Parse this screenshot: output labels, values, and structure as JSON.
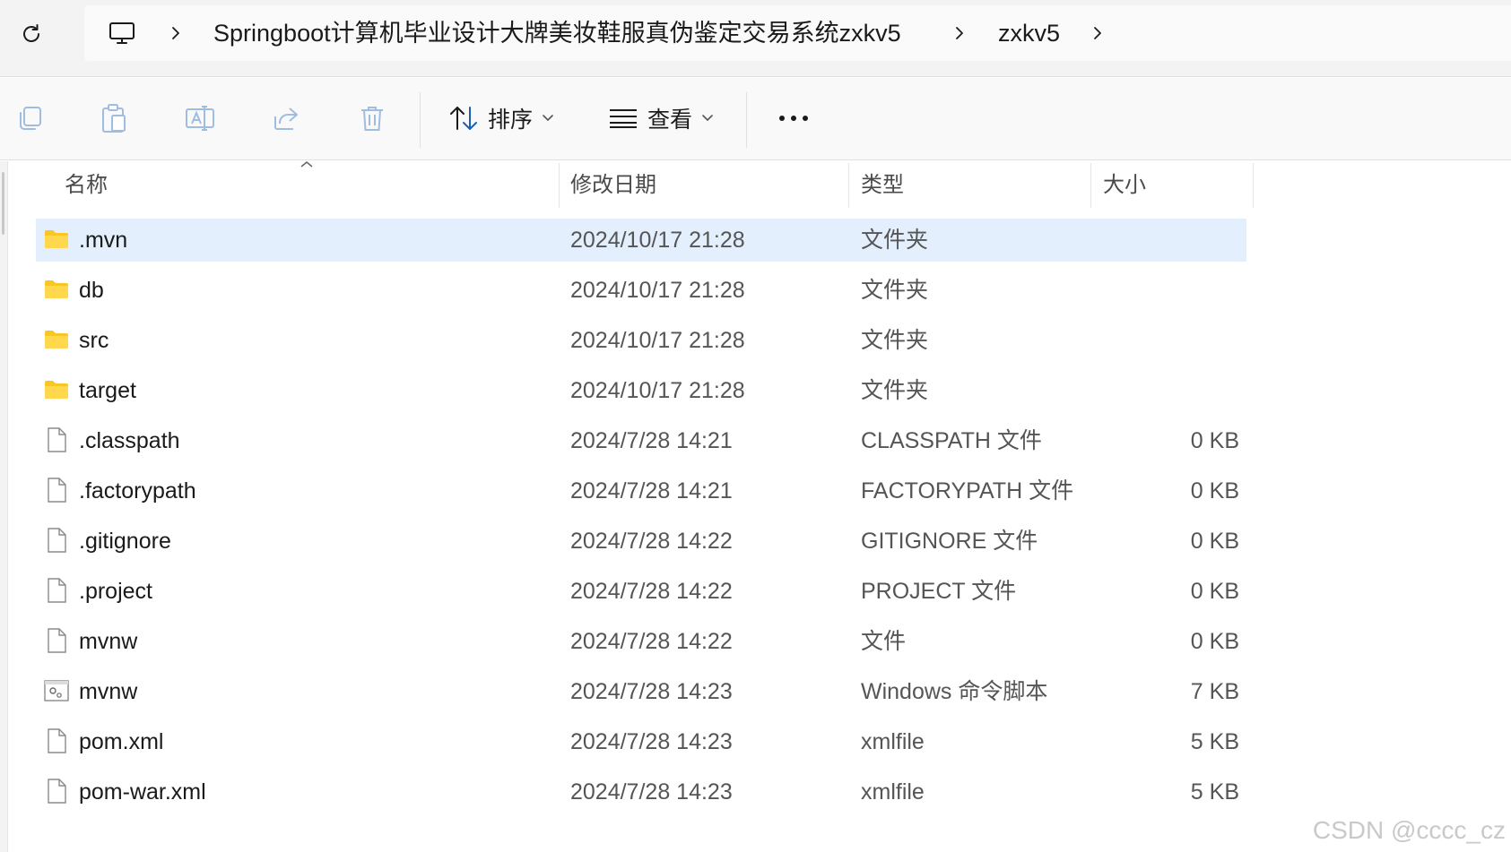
{
  "address_bar": {
    "crumbs": [
      "Springboot计算机毕业设计大牌美妆鞋服真伪鉴定交易系统zxkv5",
      "zxkv5"
    ]
  },
  "toolbar": {
    "sort_label": "排序",
    "view_label": "查看"
  },
  "columns": {
    "name": "名称",
    "modified": "修改日期",
    "type": "类型",
    "size": "大小"
  },
  "files": [
    {
      "name": ".mvn",
      "modified": "2024/10/17 21:28",
      "type": "文件夹",
      "size": "",
      "icon": "folder-icon",
      "selected": true
    },
    {
      "name": "db",
      "modified": "2024/10/17 21:28",
      "type": "文件夹",
      "size": "",
      "icon": "folder-icon"
    },
    {
      "name": "src",
      "modified": "2024/10/17 21:28",
      "type": "文件夹",
      "size": "",
      "icon": "folder-icon"
    },
    {
      "name": "target",
      "modified": "2024/10/17 21:28",
      "type": "文件夹",
      "size": "",
      "icon": "folder-icon"
    },
    {
      "name": ".classpath",
      "modified": "2024/7/28 14:21",
      "type": "CLASSPATH 文件",
      "size": "0 KB",
      "icon": "file-icon"
    },
    {
      "name": ".factorypath",
      "modified": "2024/7/28 14:21",
      "type": "FACTORYPATH 文件",
      "size": "0 KB",
      "icon": "file-icon"
    },
    {
      "name": ".gitignore",
      "modified": "2024/7/28 14:22",
      "type": "GITIGNORE 文件",
      "size": "0 KB",
      "icon": "file-icon"
    },
    {
      "name": ".project",
      "modified": "2024/7/28 14:22",
      "type": "PROJECT 文件",
      "size": "0 KB",
      "icon": "file-icon"
    },
    {
      "name": "mvnw",
      "modified": "2024/7/28 14:22",
      "type": "文件",
      "size": "0 KB",
      "icon": "file-icon"
    },
    {
      "name": "mvnw",
      "modified": "2024/7/28 14:23",
      "type": "Windows 命令脚本",
      "size": "7 KB",
      "icon": "script-file-icon"
    },
    {
      "name": "pom.xml",
      "modified": "2024/7/28 14:23",
      "type": "xmlfile",
      "size": "5 KB",
      "icon": "file-icon"
    },
    {
      "name": "pom-war.xml",
      "modified": "2024/7/28 14:23",
      "type": "xmlfile",
      "size": "5 KB",
      "icon": "file-icon"
    }
  ],
  "watermark": "CSDN @cccc_cz",
  "colors": {
    "selection": "#e3effc",
    "folder": "#f9c623",
    "toolbar_disabled_icon": "#9fbde0"
  }
}
